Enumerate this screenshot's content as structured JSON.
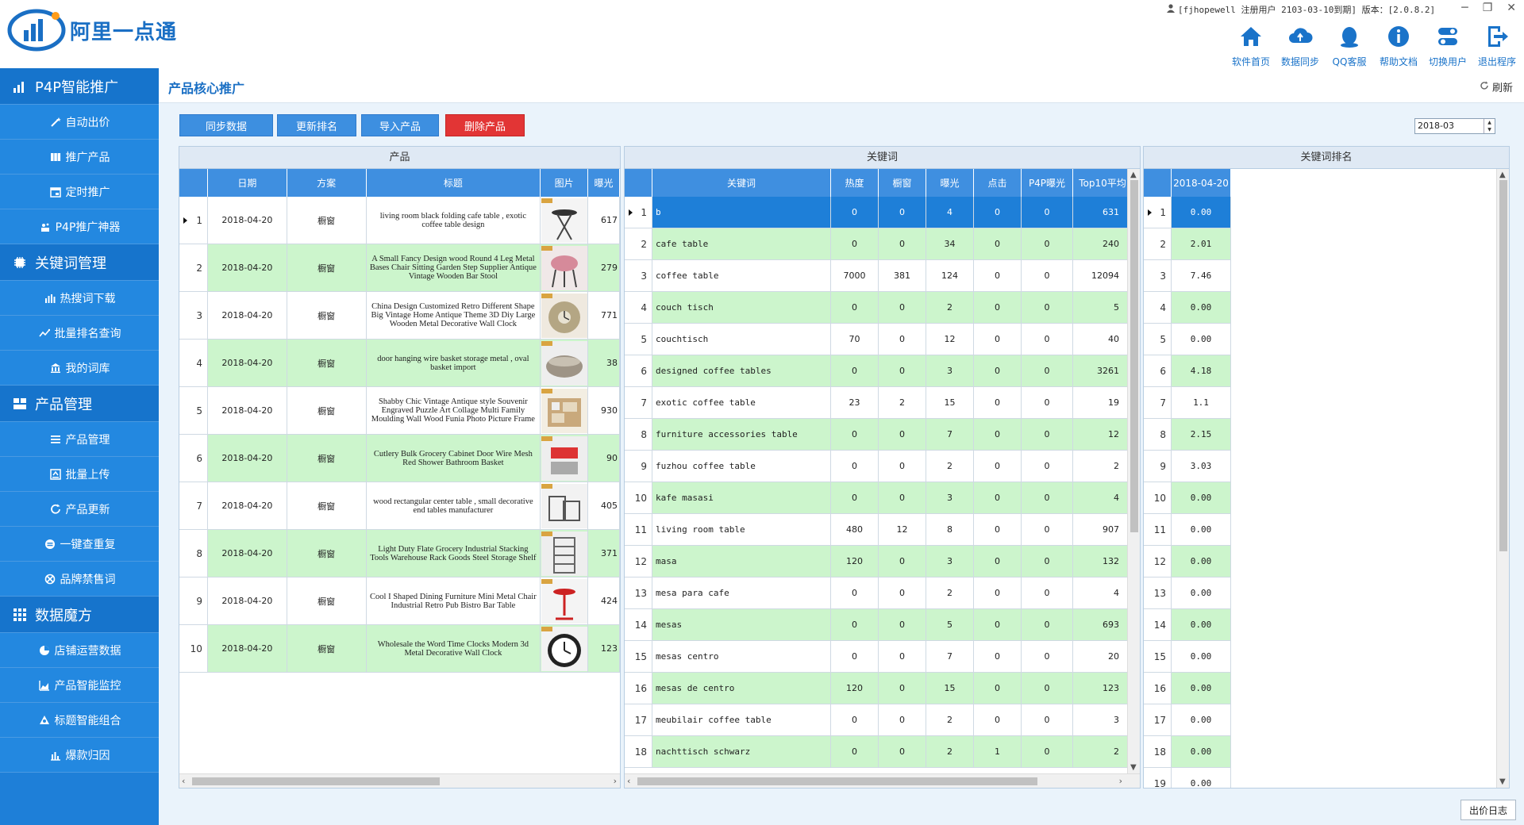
{
  "app": {
    "name": "阿里一点通",
    "user_info": "[fjhopewell 注册用户 2103-03-10到期] 版本：[2.0.8.2]"
  },
  "toolbar": [
    {
      "label": "软件首页",
      "icon": "home-icon"
    },
    {
      "label": "数据同步",
      "icon": "cloud-sync-icon"
    },
    {
      "label": "QQ客服",
      "icon": "qq-icon"
    },
    {
      "label": "帮助文档",
      "icon": "info-icon"
    },
    {
      "label": "切换用户",
      "icon": "switch-user-icon"
    },
    {
      "label": "退出程序",
      "icon": "exit-icon"
    }
  ],
  "sidebar": {
    "groups": [
      {
        "label": "P4P智能推广",
        "icon": "chart-icon",
        "items": [
          {
            "label": "自动出价",
            "icon": "wand-icon"
          },
          {
            "label": "推广产品",
            "icon": "grid-icon"
          },
          {
            "label": "定时推广",
            "icon": "calendar-icon"
          },
          {
            "label": "P4P推广神器",
            "icon": "magic-icon"
          }
        ]
      },
      {
        "label": "关键词管理",
        "icon": "chip-icon",
        "items": [
          {
            "label": "热搜词下载",
            "icon": "bars-icon"
          },
          {
            "label": "批量排名查询",
            "icon": "trend-icon"
          },
          {
            "label": "我的词库",
            "icon": "bank-icon"
          }
        ]
      },
      {
        "label": "产品管理",
        "icon": "box-icon",
        "items": [
          {
            "label": "产品管理",
            "icon": "list-icon"
          },
          {
            "label": "批量上传",
            "icon": "upload-icon"
          },
          {
            "label": "产品更新",
            "icon": "refresh-icon"
          },
          {
            "label": "一键查重复",
            "icon": "minus-circle-icon"
          },
          {
            "label": "品牌禁售词",
            "icon": "ban-icon"
          }
        ]
      },
      {
        "label": "数据魔方",
        "icon": "cube-icon",
        "items": [
          {
            "label": "店铺运营数据",
            "icon": "pie-icon"
          },
          {
            "label": "产品智能监控",
            "icon": "area-chart-icon"
          },
          {
            "label": "标题智能组合",
            "icon": "combine-icon"
          },
          {
            "label": "爆款归因",
            "icon": "column-chart-icon"
          }
        ]
      }
    ]
  },
  "page": {
    "title": "产品核心推广",
    "refresh_label": "刷新",
    "buttons": {
      "sync": "同步数据",
      "update_rank": "更新排名",
      "import": "导入产品",
      "delete": "删除产品"
    },
    "month_value": "2018-03",
    "log_button": "出价日志"
  },
  "products": {
    "title": "产品",
    "headers": [
      "日期",
      "方案",
      "标题",
      "图片",
      "曝光"
    ],
    "rows": [
      {
        "n": "1",
        "date": "2018-04-20",
        "plan": "橱窗",
        "title": "living room black folding cafe table , exotic coffee table design",
        "exposure": "617"
      },
      {
        "n": "2",
        "date": "2018-04-20",
        "plan": "橱窗",
        "title": "A Small Fancy Design wood Round 4 Leg Metal Bases Chair Sitting Garden Step Supplier Antique Vintage Wooden Bar Stool",
        "exposure": "279"
      },
      {
        "n": "3",
        "date": "2018-04-20",
        "plan": "橱窗",
        "title": "China Design Customized Retro Different Shape Big Vintage Home Antique Theme 3D Diy Large Wooden Metal Decorative Wall Clock",
        "exposure": "771"
      },
      {
        "n": "4",
        "date": "2018-04-20",
        "plan": "橱窗",
        "title": "door hanging wire basket storage metal , oval basket import",
        "exposure": "38"
      },
      {
        "n": "5",
        "date": "2018-04-20",
        "plan": "橱窗",
        "title": "Shabby Chic Vintage Antique style Souvenir Engraved Puzzle Art Collage Multi Family Moulding Wall Wood Funia Photo Picture Frame",
        "exposure": "930"
      },
      {
        "n": "6",
        "date": "2018-04-20",
        "plan": "橱窗",
        "title": "Cutlery Bulk Grocery Cabinet Door Wire Mesh Red Shower Bathroom Basket",
        "exposure": "90"
      },
      {
        "n": "7",
        "date": "2018-04-20",
        "plan": "橱窗",
        "title": "wood rectangular center table , small decorative end tables manufacturer",
        "exposure": "405"
      },
      {
        "n": "8",
        "date": "2018-04-20",
        "plan": "橱窗",
        "title": "Light Duty Flate Grocery Industrial Stacking Tools Warehouse Rack Goods Steel Storage Shelf",
        "exposure": "371"
      },
      {
        "n": "9",
        "date": "2018-04-20",
        "plan": "橱窗",
        "title": "Cool I Shaped Dining Furniture Mini Metal Chair Industrial Retro Pub Bistro Bar Table",
        "exposure": "424"
      },
      {
        "n": "10",
        "date": "2018-04-20",
        "plan": "橱窗",
        "title": "Wholesale the Word Time Clocks Modern 3d Metal Decorative Wall Clock",
        "exposure": "123"
      }
    ]
  },
  "keywords": {
    "title": "关键词",
    "headers": [
      "关键词",
      "热度",
      "橱窗",
      "曝光",
      "点击",
      "P4P曝光",
      "Top10平均"
    ],
    "rows": [
      {
        "n": "1",
        "kw": "b",
        "heat": "0",
        "win": "0",
        "exp": "4",
        "click": "0",
        "p4p": "0",
        "top10": "631"
      },
      {
        "n": "2",
        "kw": "cafe table",
        "heat": "0",
        "win": "0",
        "exp": "34",
        "click": "0",
        "p4p": "0",
        "top10": "240"
      },
      {
        "n": "3",
        "kw": "coffee table",
        "heat": "7000",
        "win": "381",
        "exp": "124",
        "click": "0",
        "p4p": "0",
        "top10": "12094"
      },
      {
        "n": "4",
        "kw": "couch tisch",
        "heat": "0",
        "win": "0",
        "exp": "2",
        "click": "0",
        "p4p": "0",
        "top10": "5"
      },
      {
        "n": "5",
        "kw": "couchtisch",
        "heat": "70",
        "win": "0",
        "exp": "12",
        "click": "0",
        "p4p": "0",
        "top10": "40"
      },
      {
        "n": "6",
        "kw": "designed coffee tables",
        "heat": "0",
        "win": "0",
        "exp": "3",
        "click": "0",
        "p4p": "0",
        "top10": "3261"
      },
      {
        "n": "7",
        "kw": "exotic coffee table",
        "heat": "23",
        "win": "2",
        "exp": "15",
        "click": "0",
        "p4p": "0",
        "top10": "19"
      },
      {
        "n": "8",
        "kw": "furniture accessories table",
        "heat": "0",
        "win": "0",
        "exp": "7",
        "click": "0",
        "p4p": "0",
        "top10": "12"
      },
      {
        "n": "9",
        "kw": "fuzhou coffee table",
        "heat": "0",
        "win": "0",
        "exp": "2",
        "click": "0",
        "p4p": "0",
        "top10": "2"
      },
      {
        "n": "10",
        "kw": "kafe masasi",
        "heat": "0",
        "win": "0",
        "exp": "3",
        "click": "0",
        "p4p": "0",
        "top10": "4"
      },
      {
        "n": "11",
        "kw": "living room table",
        "heat": "480",
        "win": "12",
        "exp": "8",
        "click": "0",
        "p4p": "0",
        "top10": "907"
      },
      {
        "n": "12",
        "kw": "masa",
        "heat": "120",
        "win": "0",
        "exp": "3",
        "click": "0",
        "p4p": "0",
        "top10": "132"
      },
      {
        "n": "13",
        "kw": "mesa para cafe",
        "heat": "0",
        "win": "0",
        "exp": "2",
        "click": "0",
        "p4p": "0",
        "top10": "4"
      },
      {
        "n": "14",
        "kw": "mesas",
        "heat": "0",
        "win": "0",
        "exp": "5",
        "click": "0",
        "p4p": "0",
        "top10": "693"
      },
      {
        "n": "15",
        "kw": "mesas centro",
        "heat": "0",
        "win": "0",
        "exp": "7",
        "click": "0",
        "p4p": "0",
        "top10": "20"
      },
      {
        "n": "16",
        "kw": "mesas de centro",
        "heat": "120",
        "win": "0",
        "exp": "15",
        "click": "0",
        "p4p": "0",
        "top10": "123"
      },
      {
        "n": "17",
        "kw": "meubilair coffee table",
        "heat": "0",
        "win": "0",
        "exp": "2",
        "click": "0",
        "p4p": "0",
        "top10": "3"
      },
      {
        "n": "18",
        "kw": "nachttisch schwarz",
        "heat": "0",
        "win": "0",
        "exp": "2",
        "click": "1",
        "p4p": "0",
        "top10": "2"
      }
    ]
  },
  "ranks": {
    "title": "关键词排名",
    "header": "2018-04-20",
    "rows": [
      {
        "n": "1",
        "v": "0.00"
      },
      {
        "n": "2",
        "v": "2.01"
      },
      {
        "n": "3",
        "v": "7.46"
      },
      {
        "n": "4",
        "v": "0.00"
      },
      {
        "n": "5",
        "v": "0.00"
      },
      {
        "n": "6",
        "v": "4.18"
      },
      {
        "n": "7",
        "v": "1.1"
      },
      {
        "n": "8",
        "v": "2.15"
      },
      {
        "n": "9",
        "v": "3.03"
      },
      {
        "n": "10",
        "v": "0.00"
      },
      {
        "n": "11",
        "v": "0.00"
      },
      {
        "n": "12",
        "v": "0.00"
      },
      {
        "n": "13",
        "v": "0.00"
      },
      {
        "n": "14",
        "v": "0.00"
      },
      {
        "n": "15",
        "v": "0.00"
      },
      {
        "n": "16",
        "v": "0.00"
      },
      {
        "n": "17",
        "v": "0.00"
      },
      {
        "n": "18",
        "v": "0.00"
      },
      {
        "n": "19",
        "v": "0.00"
      }
    ]
  },
  "colors": {
    "accent": "#1e7fd8",
    "header": "#3f8fe0",
    "row_green": "#ccf5cc",
    "delete_red": "#e23535"
  }
}
